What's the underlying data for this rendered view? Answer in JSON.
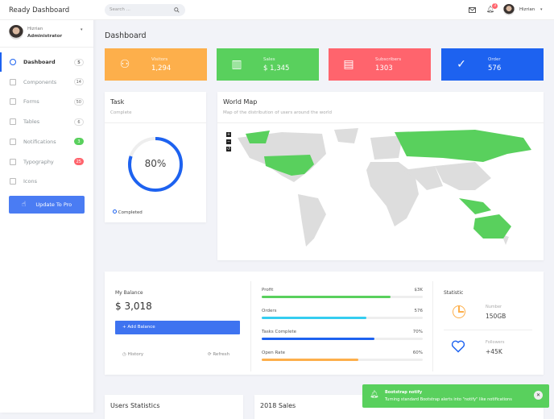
{
  "brand": "Ready Dashboard",
  "user": {
    "name": "Hizrian",
    "role": "Administrator"
  },
  "sidebar": {
    "items": [
      {
        "label": "Dashboard",
        "badge": "5",
        "style": "plain"
      },
      {
        "label": "Components",
        "badge": "14",
        "style": "plain"
      },
      {
        "label": "Forms",
        "badge": "50",
        "style": "plain"
      },
      {
        "label": "Tables",
        "badge": "6",
        "style": "plain"
      },
      {
        "label": "Notifications",
        "badge": "3",
        "style": "g"
      },
      {
        "label": "Typography",
        "badge": "25",
        "style": "r"
      },
      {
        "label": "Icons",
        "badge": null,
        "style": "plain"
      }
    ],
    "pro": "Update To Pro"
  },
  "header": {
    "search_placeholder": "Search ...",
    "notif_count": "3",
    "user": "Hizrian"
  },
  "page_title": "Dashboard",
  "stats": [
    {
      "label": "Visitors",
      "value": "1,294",
      "color": "#fdaf4b",
      "icon": "users-icon"
    },
    {
      "label": "Sales",
      "value": "$ 1,345",
      "color": "#59d05d",
      "icon": "bar-chart-icon"
    },
    {
      "label": "Subscribers",
      "value": "1303",
      "color": "#ff646d",
      "icon": "newspaper-icon"
    },
    {
      "label": "Order",
      "value": "576",
      "color": "#1d62f0",
      "icon": "check-circle-icon"
    }
  ],
  "task": {
    "title": "Task",
    "subtitle": "Complete",
    "percent": 80,
    "percent_label": "80%",
    "footer": "Completed"
  },
  "map": {
    "title": "World Map",
    "subtitle": "Map of the distribution of users around the world"
  },
  "balance": {
    "title": "My Balance",
    "amount": "$ 3,018",
    "add": "+ Add Balance",
    "history": "History",
    "refresh": "Refresh"
  },
  "progress": [
    {
      "label": "Profit",
      "value": "$3K",
      "percent": 80,
      "color": "#59d05d"
    },
    {
      "label": "Orders",
      "value": "576",
      "percent": 65,
      "color": "#35cd f0"
    },
    {
      "label": "Tasks Complete",
      "value": "70%",
      "percent": 70,
      "color": "#1d62f0"
    },
    {
      "label": "Open Rate",
      "value": "60%",
      "percent": 60,
      "color": "#fdaf4b"
    }
  ],
  "statistic": {
    "title": "Statistic",
    "items": [
      {
        "label": "Number",
        "value": "150GB"
      },
      {
        "label": "Followers",
        "value": "+45K"
      }
    ]
  },
  "bottom": {
    "users": "Users Statistics",
    "sales": "2018 Sales"
  },
  "toast": {
    "title": "Bootstrap notify",
    "message": "Turning standard Bootstrap alerts into \"notify\" like notifications"
  }
}
